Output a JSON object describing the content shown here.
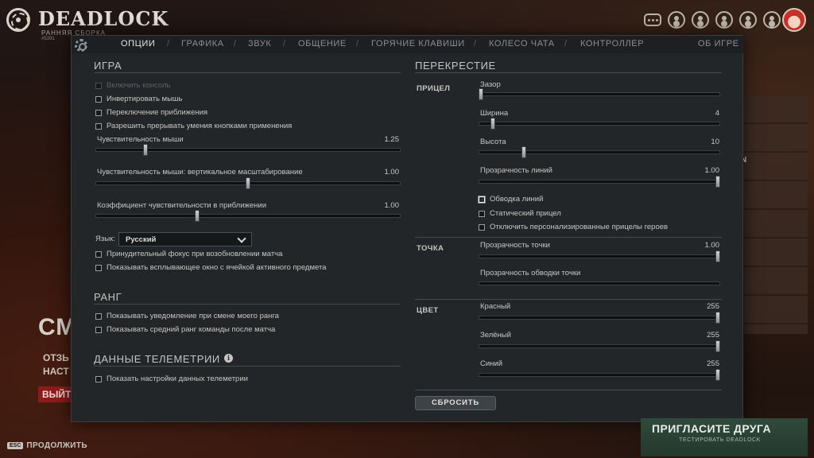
{
  "app": {
    "logo": "DEADLOCK",
    "build_label": "РАННЯЯ СБОРКА",
    "build_number": "#5391"
  },
  "tabs": [
    {
      "label": "ОПЦИИ",
      "active": true
    },
    {
      "label": "ГРАФИКА"
    },
    {
      "label": "ЗВУК"
    },
    {
      "label": "ОБЩЕНИЕ"
    },
    {
      "label": "ГОРЯЧИЕ КЛАВИШИ"
    },
    {
      "label": "КОЛЕСО ЧАТА"
    },
    {
      "label": "КОНТРОЛЛЕР"
    },
    {
      "label": "ОБ ИГРЕ"
    }
  ],
  "game": {
    "title": "ИГРА",
    "options": [
      {
        "label": "Включить консоль",
        "checked": false,
        "disabled": true
      },
      {
        "label": "Инвертировать мышь",
        "checked": false
      },
      {
        "label": "Переключение приближения",
        "checked": false
      },
      {
        "label": "Разрешить прерывать умения кнопками применения",
        "checked": false
      }
    ],
    "sliders": [
      {
        "label": "Чувствительность мыши",
        "value": "1.25",
        "fraction": 0.16
      },
      {
        "label": "Чувствительность мыши: вертикальное масштабирование",
        "value": "1.00",
        "fraction": 0.5
      },
      {
        "label": "Коэффициент чувствительности в приближении",
        "value": "1.00",
        "fraction": 0.33
      }
    ],
    "language_label": "Язык:",
    "language_value": "Русский",
    "options2": [
      {
        "label": "Принудительный фокус при возобновлении матча",
        "checked": false
      },
      {
        "label": "Показывать всплывающее окно с ячейкой активного предмета",
        "checked": false
      }
    ]
  },
  "rank": {
    "title": "РАНГ",
    "options": [
      {
        "label": "Показывать уведомление при смене моего ранга",
        "checked": false
      },
      {
        "label": "Показывать средний ранг команды после матча",
        "checked": false
      }
    ]
  },
  "telemetry": {
    "title": "ДАННЫЕ ТЕЛЕМЕТРИИ",
    "info_icon": "i",
    "options": [
      {
        "label": "Показать настройки данных телеметрии",
        "checked": false
      }
    ]
  },
  "crosshair": {
    "title": "ПЕРЕКРЕСТИЕ",
    "reticle": {
      "label": "ПРИЦЕЛ",
      "sliders": [
        {
          "label": "Зазор",
          "value": "",
          "fraction": 0.0
        },
        {
          "label": "Ширина",
          "value": "4",
          "fraction": 0.05
        },
        {
          "label": "Высота",
          "value": "10",
          "fraction": 0.18
        },
        {
          "label": "Прозрачность линий",
          "value": "1.00",
          "fraction": 1.0
        }
      ],
      "options": [
        {
          "label": "Обводка линий",
          "checked": false,
          "focused": true
        },
        {
          "label": "Статический прицел",
          "checked": false
        },
        {
          "label": "Отключить персонализированные прицелы героев",
          "checked": false
        }
      ]
    },
    "dot": {
      "label": "ТОЧКА",
      "sliders": [
        {
          "label": "Прозрачность точки",
          "value": "1.00",
          "fraction": 1.0
        },
        {
          "label": "Прозрачность обводки точки",
          "value": "",
          "fraction": 0.0
        }
      ]
    },
    "color": {
      "label": "ЦВЕТ",
      "sliders": [
        {
          "label": "Красный",
          "value": "255",
          "fraction": 1.0
        },
        {
          "label": "Зелёный",
          "value": "255",
          "fraction": 1.0
        },
        {
          "label": "Синий",
          "value": "255",
          "fraction": 1.0
        }
      ]
    },
    "reset_label": "СБРОСИТЬ"
  },
  "background": {
    "heading": "СМ",
    "line1": "ОТЗЬ",
    "line2": "НАСТ",
    "exit_label": "ВЫЙТ",
    "right_letter": "N"
  },
  "footer": {
    "esc_key": "ESC",
    "continue_label": "ПРОДОЛЖИТЬ",
    "invite_title": "ПРИГЛАСИТЕ ДРУГА",
    "invite_sub": "ТЕСТИРОВАТЬ DEADLOCK"
  },
  "colors": {
    "modal_bg": "#232629",
    "accent_text": "#e8e6e2",
    "invite_bg": "#2f4a3c",
    "exit_bg": "#8c1c1c"
  }
}
